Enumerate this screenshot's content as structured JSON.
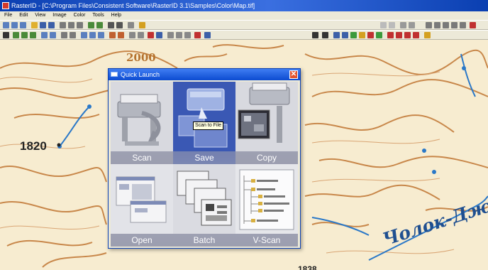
{
  "window": {
    "title": "RasterID - [C:\\Program Files\\Consistent Software\\RasterID 3.1\\Samples\\Color\\Map.tif]"
  },
  "menu": [
    "File",
    "Edit",
    "View",
    "Image",
    "Color",
    "Tools",
    "Help"
  ],
  "map": {
    "labels": {
      "elev_1820": "1820",
      "elev_2000": "2000",
      "river": "Чолок-Джа",
      "bottom": "1838"
    },
    "colors": {
      "contour": "#c8874a",
      "river": "#2a78c8",
      "paper": "#f7ecd0"
    }
  },
  "quick_launch": {
    "title": "Quick Launch",
    "close_glyph": "✕",
    "tooltip": "Scan to File",
    "tiles": [
      {
        "label": "Scan",
        "icon": "scanner-icon"
      },
      {
        "label": "Save",
        "icon": "scan-to-file-icon"
      },
      {
        "label": "Copy",
        "icon": "copier-icon"
      },
      {
        "label": "Open",
        "icon": "open-image-icon"
      },
      {
        "label": "Batch",
        "icon": "batch-documents-icon"
      },
      {
        "label": "V-Scan",
        "icon": "vector-tree-icon"
      }
    ]
  }
}
